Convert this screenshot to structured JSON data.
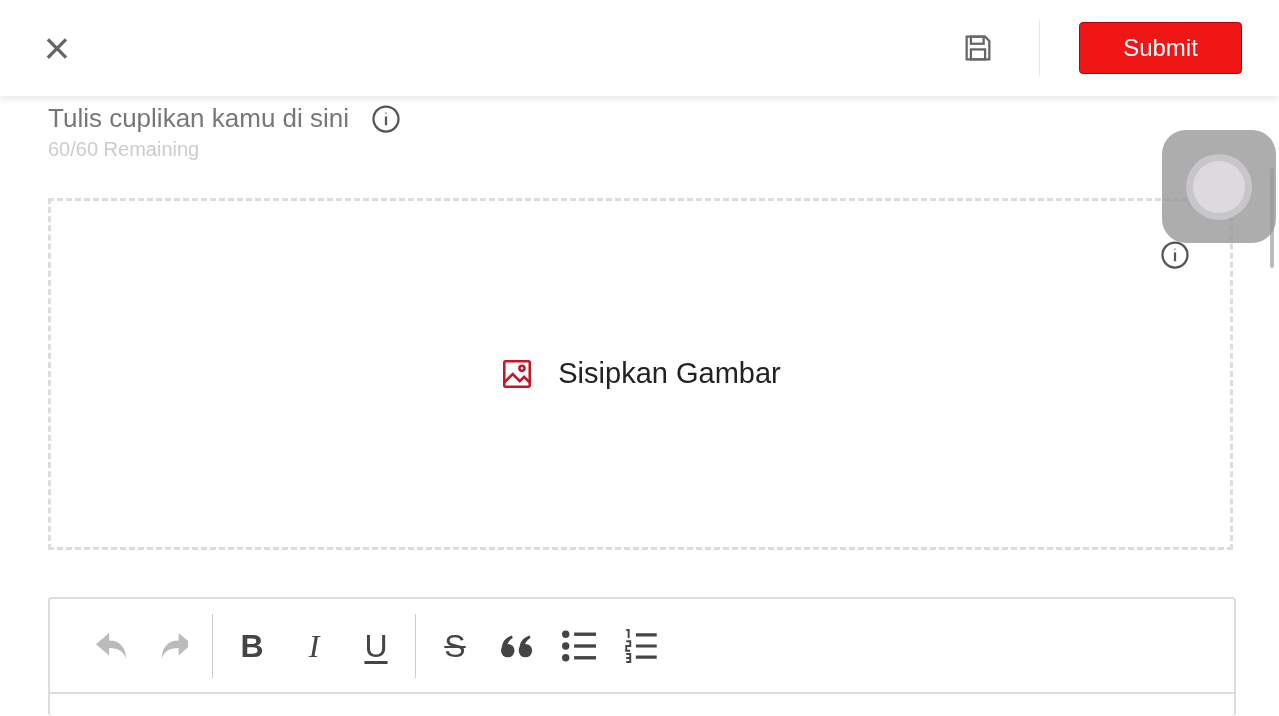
{
  "header": {
    "close": "×",
    "submit": "Submit"
  },
  "title": {
    "text": "Tulis cuplikan kamu di sini",
    "counter": "60/60 Remaining"
  },
  "image_drop": {
    "label": "Sisipkan Gambar"
  },
  "toolbar": [
    {
      "kind": "undo",
      "disabled": true
    },
    {
      "kind": "redo",
      "disabled": true
    },
    {
      "kind": "separator"
    },
    {
      "kind": "bold",
      "text": "B",
      "disabled": false
    },
    {
      "kind": "italic",
      "text": "I",
      "disabled": false
    },
    {
      "kind": "underline",
      "text": "U",
      "disabled": false
    },
    {
      "kind": "separator"
    },
    {
      "kind": "strike",
      "text": "S",
      "disabled": false
    },
    {
      "kind": "quote",
      "disabled": false
    },
    {
      "kind": "bullets",
      "disabled": false
    },
    {
      "kind": "numbers",
      "disabled": false
    }
  ]
}
